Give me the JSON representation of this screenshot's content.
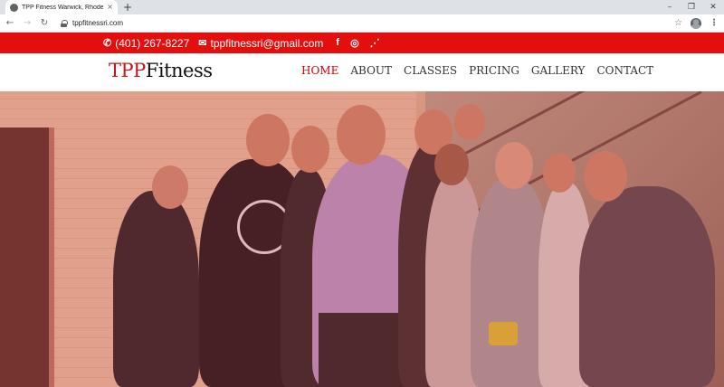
{
  "browser": {
    "tab_title": "TPP Fitness Warwick, Rhode Islan",
    "tab_close": "×",
    "new_tab": "+",
    "url": "tppfitnessri.com",
    "icons": {
      "favicon": "globe-icon",
      "back": "arrow-left-icon",
      "forward": "arrow-right-icon",
      "reload": "reload-icon",
      "lock": "lock-icon",
      "bookmark": "star-icon",
      "profile": "profile-icon",
      "menu": "kebab-menu-icon"
    },
    "window_controls": [
      "–",
      "❐",
      "✕"
    ]
  },
  "topbar": {
    "phone": "(401) 267-8227",
    "email": "tppfitnessri@gmail.com",
    "phone_icon": "phone-icon",
    "email_icon": "envelope-icon",
    "social_icons": [
      "facebook-icon",
      "instagram-icon",
      "rss-icon"
    ],
    "background_color": "#e30f0f"
  },
  "header": {
    "logo_part1": "TPP",
    "logo_part2": "Fitness",
    "nav": [
      {
        "label": "HOME",
        "active": true
      },
      {
        "label": "ABOUT",
        "active": false
      },
      {
        "label": "CLASSES",
        "active": false
      },
      {
        "label": "PRICING",
        "active": false
      },
      {
        "label": "GALLERY",
        "active": false
      },
      {
        "label": "CONTACT",
        "active": false
      }
    ],
    "accent_color": "#d40000"
  }
}
